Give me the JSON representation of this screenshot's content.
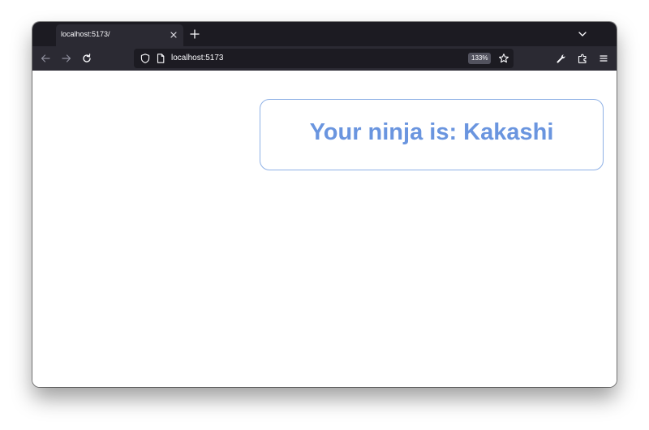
{
  "browser": {
    "tab": {
      "title": "localhost:5173/",
      "close_icon": "close-icon"
    },
    "new_tab_icon": "plus-icon",
    "tab_list_icon": "chevron-down-icon",
    "nav": {
      "back_icon": "arrow-left-icon",
      "forward_icon": "arrow-right-icon",
      "reload_icon": "reload-icon"
    },
    "urlbar": {
      "shield_icon": "shield-icon",
      "page_icon": "page-icon",
      "url": "localhost:5173",
      "zoom": "133%",
      "bookmark_icon": "star-icon"
    },
    "toolbar": {
      "wrench_icon": "wrench-icon",
      "extensions_icon": "puzzle-icon",
      "menu_icon": "hamburger-menu-icon"
    },
    "colors": {
      "tabstrip_bg": "#1c1b22",
      "toolbar_bg": "#2b2a33",
      "accent_text": "#6a95df",
      "card_border": "#8fb1e6"
    }
  },
  "page": {
    "ninja_text": "Your ninja is: Kakashi"
  }
}
